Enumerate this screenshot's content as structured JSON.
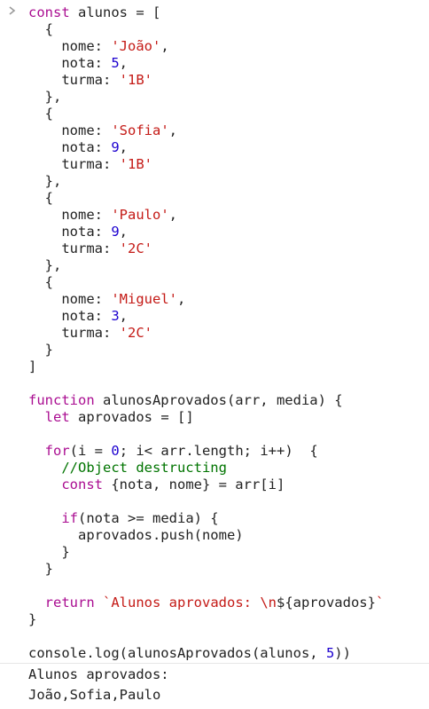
{
  "input": {
    "prompt_icon": "chevron-right-icon",
    "lines": [
      [
        {
          "t": "const",
          "c": "kw"
        },
        {
          "t": " alunos = [",
          "c": "pl"
        }
      ],
      [
        {
          "t": "  {",
          "c": "pl"
        }
      ],
      [
        {
          "t": "    nome: ",
          "c": "pl"
        },
        {
          "t": "'João'",
          "c": "str"
        },
        {
          "t": ",",
          "c": "pl"
        }
      ],
      [
        {
          "t": "    nota: ",
          "c": "pl"
        },
        {
          "t": "5",
          "c": "num"
        },
        {
          "t": ",",
          "c": "pl"
        }
      ],
      [
        {
          "t": "    turma: ",
          "c": "pl"
        },
        {
          "t": "'1B'",
          "c": "str"
        }
      ],
      [
        {
          "t": "  },",
          "c": "pl"
        }
      ],
      [
        {
          "t": "  {",
          "c": "pl"
        }
      ],
      [
        {
          "t": "    nome: ",
          "c": "pl"
        },
        {
          "t": "'Sofia'",
          "c": "str"
        },
        {
          "t": ",",
          "c": "pl"
        }
      ],
      [
        {
          "t": "    nota: ",
          "c": "pl"
        },
        {
          "t": "9",
          "c": "num"
        },
        {
          "t": ",",
          "c": "pl"
        }
      ],
      [
        {
          "t": "    turma: ",
          "c": "pl"
        },
        {
          "t": "'1B'",
          "c": "str"
        }
      ],
      [
        {
          "t": "  },",
          "c": "pl"
        }
      ],
      [
        {
          "t": "  {",
          "c": "pl"
        }
      ],
      [
        {
          "t": "    nome: ",
          "c": "pl"
        },
        {
          "t": "'Paulo'",
          "c": "str"
        },
        {
          "t": ",",
          "c": "pl"
        }
      ],
      [
        {
          "t": "    nota: ",
          "c": "pl"
        },
        {
          "t": "9",
          "c": "num"
        },
        {
          "t": ",",
          "c": "pl"
        }
      ],
      [
        {
          "t": "    turma: ",
          "c": "pl"
        },
        {
          "t": "'2C'",
          "c": "str"
        }
      ],
      [
        {
          "t": "  },",
          "c": "pl"
        }
      ],
      [
        {
          "t": "  {",
          "c": "pl"
        }
      ],
      [
        {
          "t": "    nome: ",
          "c": "pl"
        },
        {
          "t": "'Miguel'",
          "c": "str"
        },
        {
          "t": ",",
          "c": "pl"
        }
      ],
      [
        {
          "t": "    nota: ",
          "c": "pl"
        },
        {
          "t": "3",
          "c": "num"
        },
        {
          "t": ",",
          "c": "pl"
        }
      ],
      [
        {
          "t": "    turma: ",
          "c": "pl"
        },
        {
          "t": "'2C'",
          "c": "str"
        }
      ],
      [
        {
          "t": "  }",
          "c": "pl"
        }
      ],
      [
        {
          "t": "]",
          "c": "pl"
        }
      ],
      [],
      [
        {
          "t": "function",
          "c": "kw"
        },
        {
          "t": " alunosAprovados(arr, media) {",
          "c": "pl"
        }
      ],
      [
        {
          "t": "  ",
          "c": "pl"
        },
        {
          "t": "let",
          "c": "kw"
        },
        {
          "t": " aprovados = []",
          "c": "pl"
        }
      ],
      [],
      [
        {
          "t": "  ",
          "c": "pl"
        },
        {
          "t": "for",
          "c": "kw"
        },
        {
          "t": "(i = ",
          "c": "pl"
        },
        {
          "t": "0",
          "c": "num"
        },
        {
          "t": "; i< arr.length; i++)  {",
          "c": "pl"
        }
      ],
      [
        {
          "t": "    ",
          "c": "pl"
        },
        {
          "t": "//Object destructing",
          "c": "cmt"
        }
      ],
      [
        {
          "t": "    ",
          "c": "pl"
        },
        {
          "t": "const",
          "c": "kw"
        },
        {
          "t": " {nota, nome} = arr[i]",
          "c": "pl"
        }
      ],
      [],
      [
        {
          "t": "    ",
          "c": "pl"
        },
        {
          "t": "if",
          "c": "kw"
        },
        {
          "t": "(nota >= media) {",
          "c": "pl"
        }
      ],
      [
        {
          "t": "      aprovados.push(nome)",
          "c": "pl"
        }
      ],
      [
        {
          "t": "    }",
          "c": "pl"
        }
      ],
      [
        {
          "t": "  }",
          "c": "pl"
        }
      ],
      [],
      [
        {
          "t": "  ",
          "c": "pl"
        },
        {
          "t": "return",
          "c": "kw"
        },
        {
          "t": " ",
          "c": "pl"
        },
        {
          "t": "`Alunos aprovados: \\n",
          "c": "str"
        },
        {
          "t": "${aprovados}",
          "c": "pl"
        },
        {
          "t": "`",
          "c": "str"
        }
      ],
      [
        {
          "t": "}",
          "c": "pl"
        }
      ],
      [],
      [
        {
          "t": "console.log(alunosAprovados(alunos, ",
          "c": "pl"
        },
        {
          "t": "5",
          "c": "num"
        },
        {
          "t": "))",
          "c": "pl"
        }
      ]
    ]
  },
  "output": {
    "lines": [
      "Alunos aprovados: ",
      "João,Sofia,Paulo"
    ]
  },
  "colors": {
    "keyword": "#aa0d91",
    "string": "#c41a16",
    "number": "#1c00cf",
    "comment": "#007400",
    "plain": "#222222",
    "divider": "#e6e6e6"
  }
}
